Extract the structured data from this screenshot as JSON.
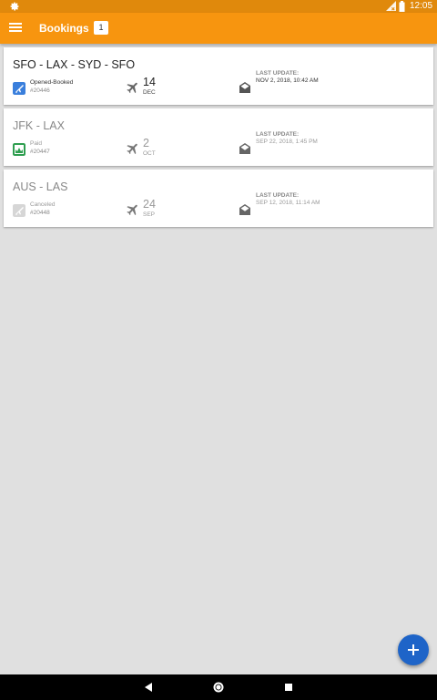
{
  "status_bar": {
    "time": "12:05",
    "icons": [
      "gear-icon",
      "signal-icon",
      "battery-icon"
    ]
  },
  "app_bar": {
    "title": "Bookings",
    "badge": "1",
    "menu_icon": "hamburger-menu-icon"
  },
  "bookings": [
    {
      "route": "SFO - LAX - SYD - SFO",
      "status": "Opened-Booked",
      "status_icon": "plane-ticket-icon",
      "status_color": "#3a7fdc",
      "number": "#20446",
      "day": "14",
      "month": "DEC",
      "last_update_label": "LAST UPDATE:",
      "last_update": "NOV 2, 2018, 10:42 AM"
    },
    {
      "route": "JFK - LAX",
      "status": "Paid",
      "status_icon": "paid-icon",
      "status_color": "#2e9e4f",
      "number": "#20447",
      "day": "2",
      "month": "OCT",
      "last_update_label": "LAST UPDATE:",
      "last_update": "SEP 22, 2018, 1:45 PM"
    },
    {
      "route": "AUS - LAS",
      "status": "Canceled",
      "status_icon": "canceled-icon",
      "status_color": "#cccccc",
      "number": "#20448",
      "day": "24",
      "month": "SEP",
      "last_update_label": "LAST UPDATE:",
      "last_update": "SEP 12, 2018, 11:14 AM"
    }
  ],
  "fab": {
    "icon": "plus-icon"
  },
  "nav_bar": {
    "icons": [
      "back-icon",
      "home-icon",
      "recents-icon"
    ]
  },
  "colors": {
    "status_bar": "#e0890c",
    "app_bar": "#f7950f",
    "fab": "#1e64c8",
    "background": "#e0e0e0"
  }
}
